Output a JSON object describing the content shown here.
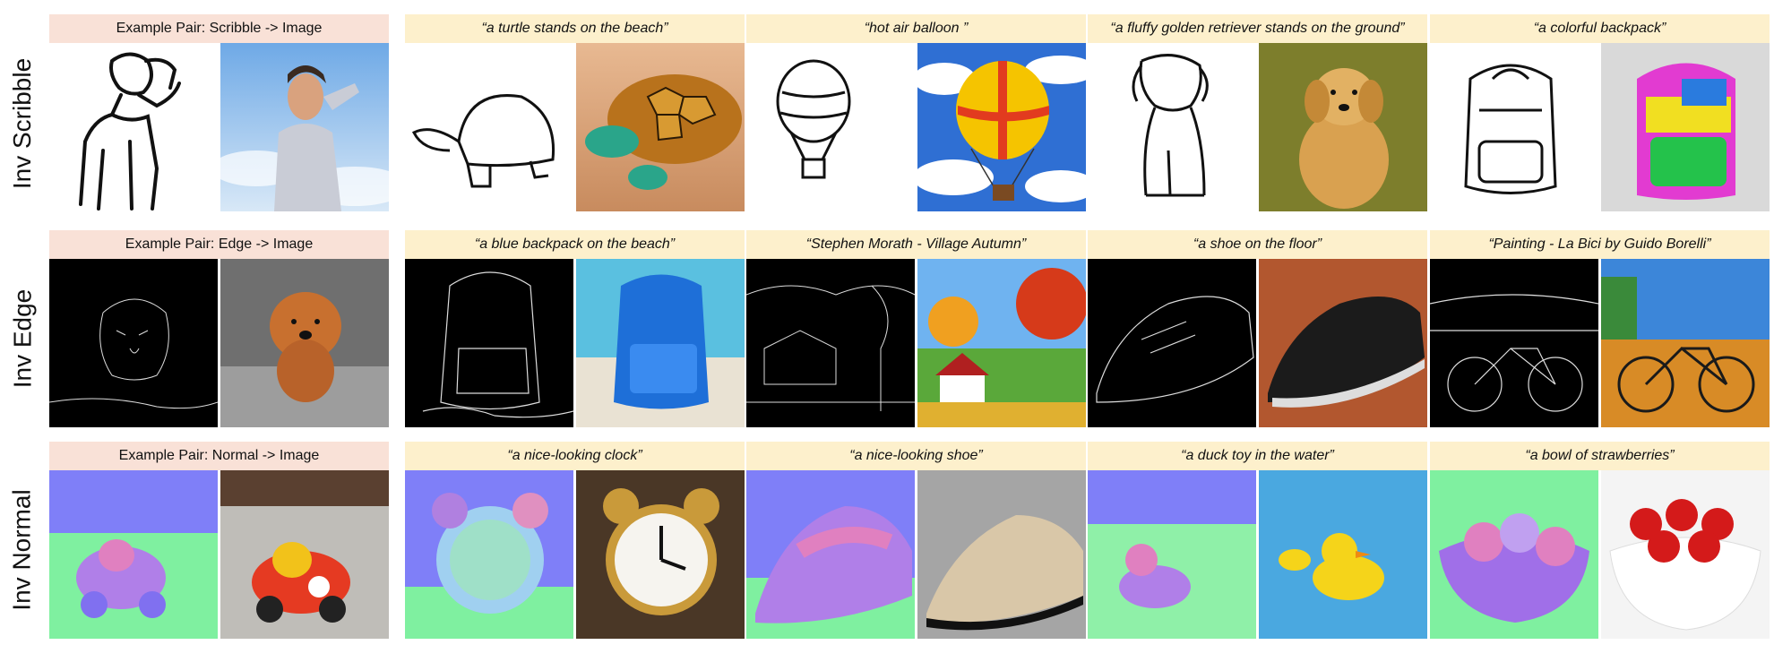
{
  "rows": [
    {
      "label": "Inv Scribble",
      "example": "Example Pair: Scribble -> Image",
      "prompts": [
        "“a turtle stands on the beach”",
        "“hot air balloon ”",
        "“a fluffy golden retriever stands on the ground”",
        "“a colorful backpack”"
      ]
    },
    {
      "label": "Inv Edge",
      "example": "Example Pair: Edge -> Image",
      "prompts": [
        "“a blue backpack on the beach”",
        "“Stephen Morath - Village Autumn”",
        "“a shoe on the floor”",
        "“Painting - La Bici by Guido Borelli”"
      ]
    },
    {
      "label": "Inv Normal",
      "example": "Example Pair: Normal -> Image",
      "prompts": [
        "“a nice-looking clock”",
        "“a nice-looking shoe”",
        "“a duck toy in the water”",
        "“a bowl of strawberries”"
      ]
    }
  ],
  "colors": {
    "example_caption_bg": "#f9e1d7",
    "prompt_caption_bg": "#fdf0cc"
  }
}
